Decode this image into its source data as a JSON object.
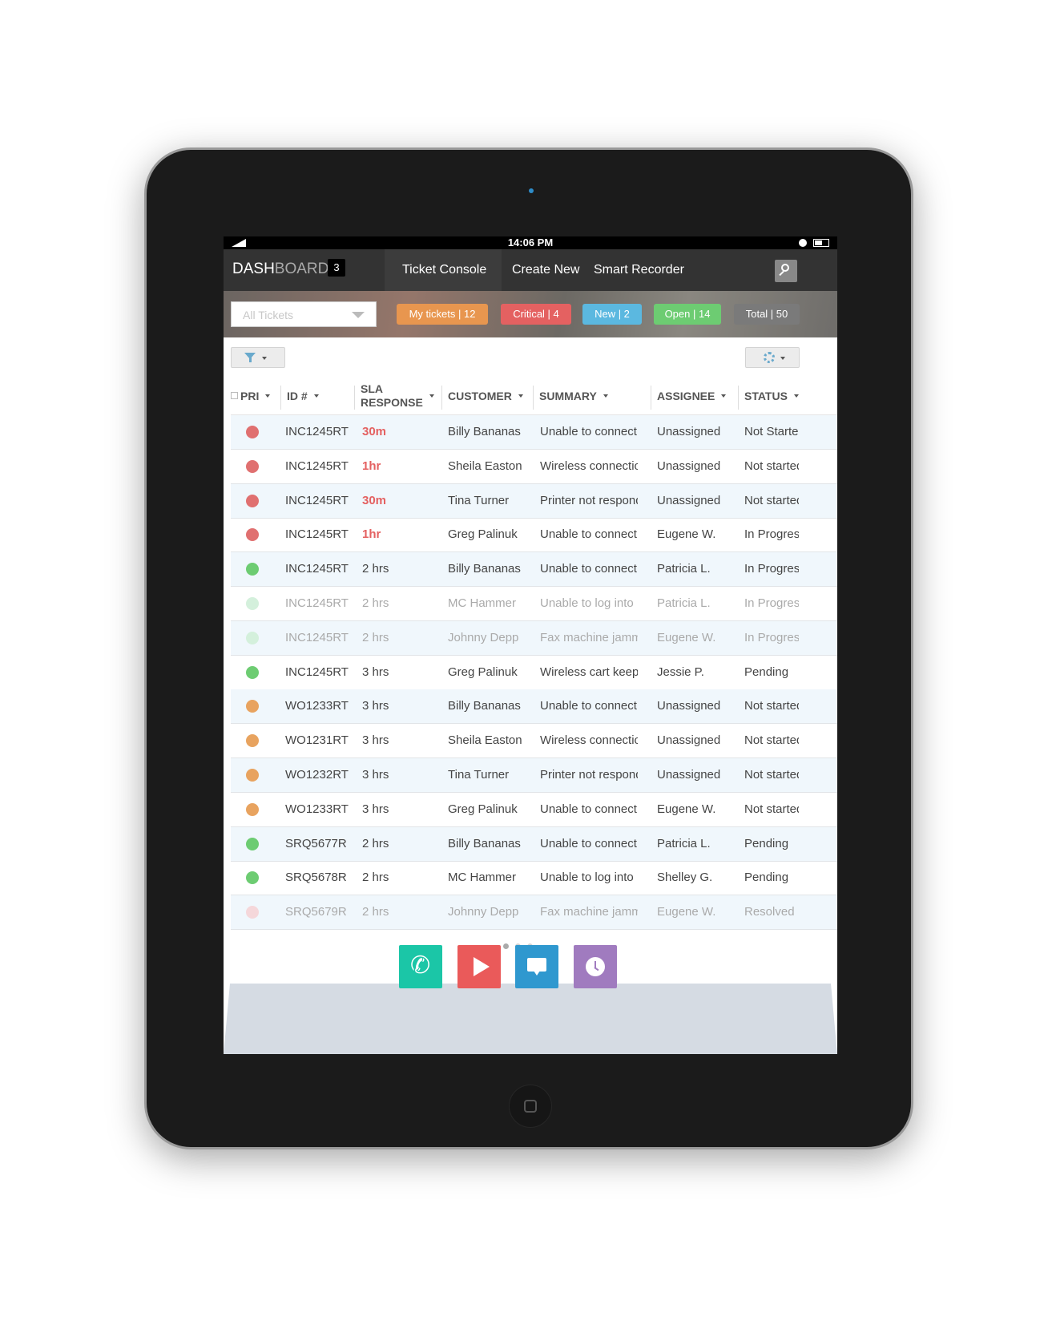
{
  "status_bar": {
    "time": "14:06 PM"
  },
  "nav": {
    "brand_main": "DASH",
    "brand_dim": "BOARD",
    "brand_count": "3",
    "tabs": [
      "Ticket Console",
      "Create New",
      "Smart Recorder"
    ]
  },
  "filters": {
    "ticket_select_placeholder": "All Tickets",
    "pills": [
      {
        "label": "My tickets  |  12",
        "color": "#e8964f"
      },
      {
        "label": "Critical  |  4",
        "color": "#e46161"
      },
      {
        "label": "New  |  2",
        "color": "#5bb8e0"
      },
      {
        "label": "Open  |  14",
        "color": "#6dcc72"
      },
      {
        "label": "Total  |  50",
        "color": "#7a7a7a"
      }
    ]
  },
  "table": {
    "columns": [
      "PRI",
      "ID #",
      "SLA\nRESPONSE",
      "CUSTOMER",
      "SUMMARY",
      "ASSIGNEE",
      "STATUS"
    ],
    "rows": [
      {
        "pri": "#e07070",
        "id": "INC1245RT",
        "sla": "30m",
        "customer": "Billy Bananas",
        "summary": "Unable to connect",
        "assignee": "Unassigned",
        "status": "Not Started"
      },
      {
        "pri": "#e07070",
        "id": "INC1245RT",
        "sla": "1hr",
        "customer": "Sheila Easton",
        "summary": "Wireless connection",
        "assignee": "Unassigned",
        "status": "Not started"
      },
      {
        "pri": "#e07070",
        "id": "INC1245RT",
        "sla": "30m",
        "customer": "Tina Turner",
        "summary": "Printer not responding",
        "assignee": "Unassigned",
        "status": "Not started"
      },
      {
        "pri": "#e07070",
        "id": "INC1245RT",
        "sla": "1hr",
        "customer": "Greg Palinuk",
        "summary": "Unable to connect",
        "assignee": "Eugene W.",
        "status": "In Progress"
      },
      {
        "pri": "#6dcc72",
        "id": "INC1245RT",
        "sla": "2 hrs",
        "customer": "Billy Bananas",
        "summary": "Unable to connect",
        "assignee": "Patricia L.",
        "status": "In Progress"
      },
      {
        "pri": "#d4f0dc",
        "id": "INC1245RT",
        "sla": "2 hrs",
        "customer": "MC Hammer",
        "summary": "Unable to log into",
        "assignee": "Patricia L.",
        "status": "In Progress"
      },
      {
        "pri": "#d4f0dc",
        "id": "INC1245RT",
        "sla": "2 hrs",
        "customer": "Johnny Depp",
        "summary": "Fax machine jammed",
        "assignee": "Eugene W.",
        "status": "In Progress"
      },
      {
        "pri": "#6dcc72",
        "id": "INC1245RT",
        "sla": "3 hrs",
        "customer": "Greg Palinuk",
        "summary": "Wireless cart keeps",
        "assignee": "Jessie P.",
        "status": "Pending"
      },
      {
        "pri": "#e8a35f",
        "id": "WO1233RT",
        "sla": "3 hrs",
        "customer": "Billy Bananas",
        "summary": "Unable to connect",
        "assignee": "Unassigned",
        "status": "Not started"
      },
      {
        "pri": "#e8a35f",
        "id": "WO1231RT",
        "sla": "3 hrs",
        "customer": "Sheila Easton",
        "summary": "Wireless connection",
        "assignee": "Unassigned",
        "status": "Not started"
      },
      {
        "pri": "#e8a35f",
        "id": "WO1232RT",
        "sla": "3 hrs",
        "customer": "Tina Turner",
        "summary": "Printer not responding",
        "assignee": "Unassigned",
        "status": "Not started"
      },
      {
        "pri": "#e8a35f",
        "id": "WO1233RT",
        "sla": "3 hrs",
        "customer": "Greg Palinuk",
        "summary": "Unable to connect",
        "assignee": "Eugene W.",
        "status": "Not started"
      },
      {
        "pri": "#6dcc72",
        "id": "SRQ5677R",
        "sla": "2 hrs",
        "customer": "Billy Bananas",
        "summary": "Unable to connect",
        "assignee": "Patricia L.",
        "status": "Pending"
      },
      {
        "pri": "#6dcc72",
        "id": "SRQ5678R",
        "sla": "2 hrs",
        "customer": "MC Hammer",
        "summary": "Unable to log into",
        "assignee": "Shelley G.",
        "status": "Pending"
      },
      {
        "pri": "#f5d7da",
        "id": "SRQ5679R",
        "sla": "2 hrs",
        "customer": "Johnny Depp",
        "summary": "Fax machine jammed",
        "assignee": "Eugene W.",
        "status": "Resolved"
      }
    ]
  },
  "dock": {
    "buttons": [
      {
        "name": "phone",
        "color": "#1bc6a7"
      },
      {
        "name": "play",
        "color": "#ea5a5a"
      },
      {
        "name": "chat",
        "color": "#2f98cf"
      },
      {
        "name": "clock",
        "color": "#a07bbf"
      }
    ]
  }
}
